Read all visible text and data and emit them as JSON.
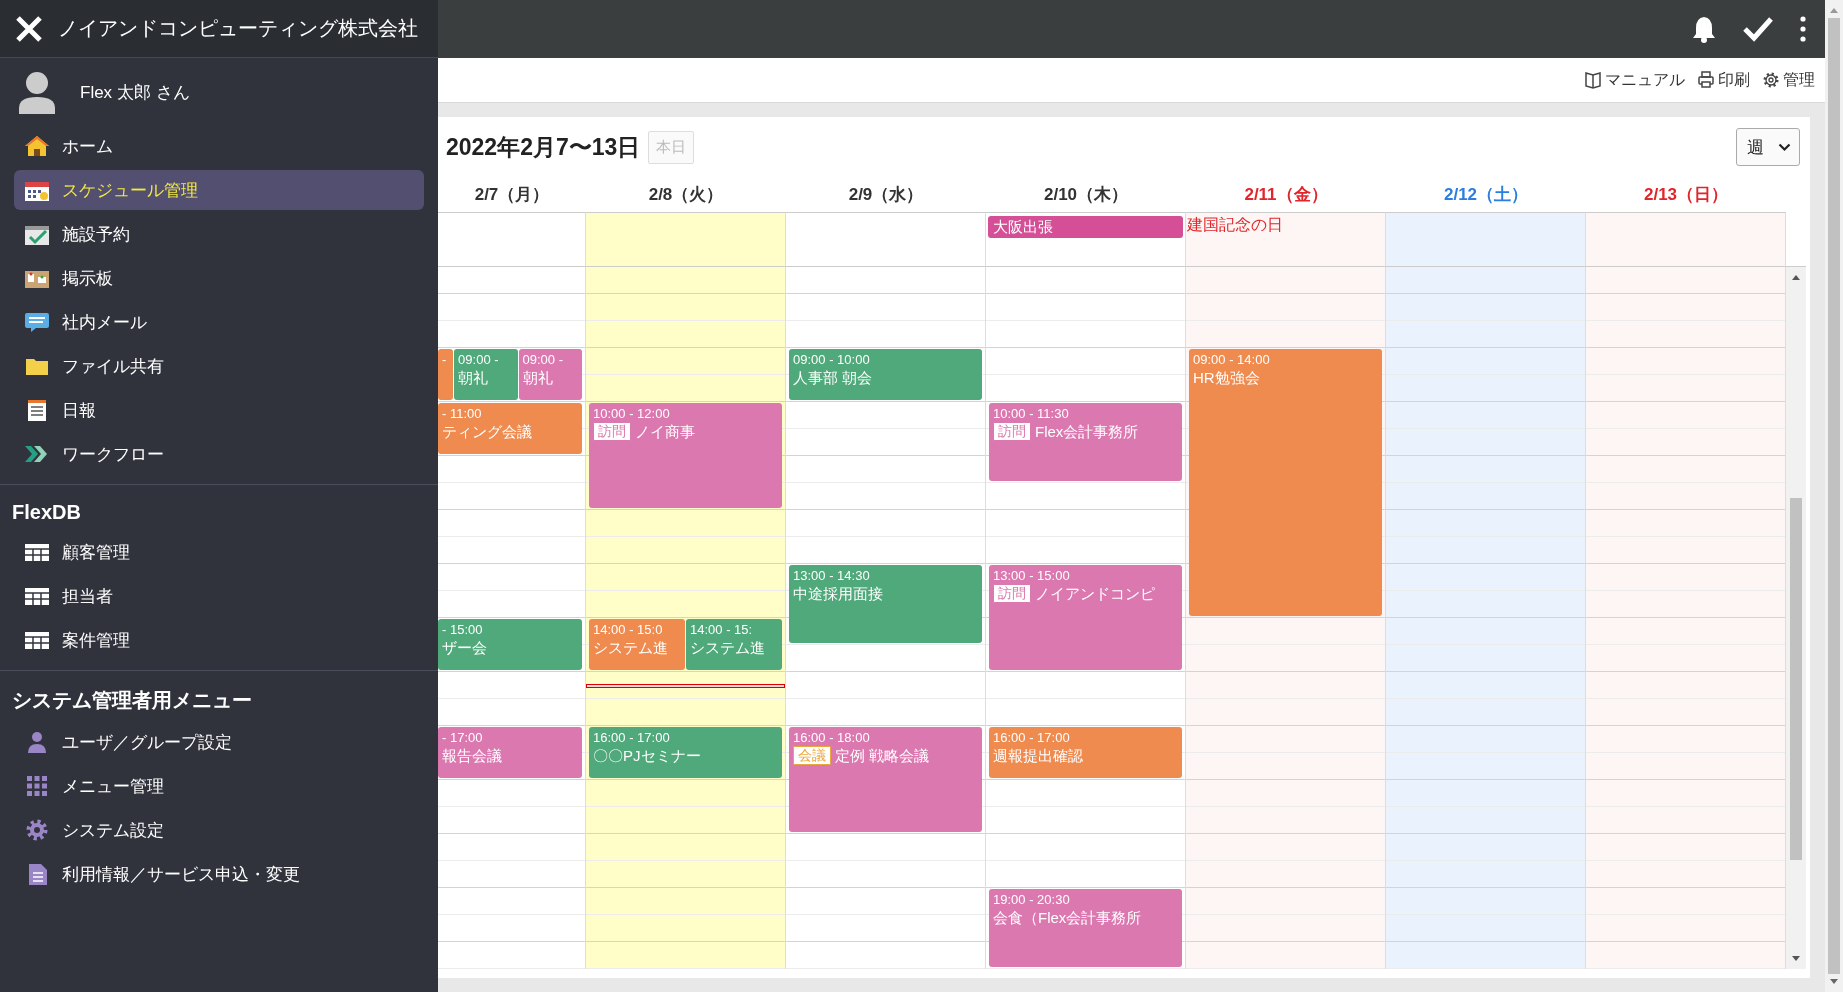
{
  "drawer": {
    "company": "ノイアンドコンピューティング株式会社",
    "user": "Flex 太郎 さん",
    "sections": [
      {
        "items": [
          {
            "label": "ホーム",
            "selected": false
          },
          {
            "label": "スケジュール管理",
            "selected": true
          },
          {
            "label": "施設予約",
            "selected": false
          },
          {
            "label": "掲示板",
            "selected": false
          },
          {
            "label": "社内メール",
            "selected": false
          },
          {
            "label": "ファイル共有",
            "selected": false
          },
          {
            "label": "日報",
            "selected": false
          },
          {
            "label": "ワークフロー",
            "selected": false
          }
        ]
      },
      {
        "heading": "FlexDB",
        "items": [
          {
            "label": "顧客管理",
            "selected": false
          },
          {
            "label": "担当者",
            "selected": false
          },
          {
            "label": "案件管理",
            "selected": false
          }
        ]
      },
      {
        "heading": "システム管理者用メニュー",
        "items": [
          {
            "label": "ユーザ／グループ設定",
            "selected": false
          },
          {
            "label": "メニュー管理",
            "selected": false
          },
          {
            "label": "システム設定",
            "selected": false
          },
          {
            "label": "利用情報／サービス申込・変更",
            "selected": false
          }
        ]
      }
    ]
  },
  "toolbar": {
    "links": [
      "マニュアル",
      "印刷",
      "管理"
    ]
  },
  "calendar": {
    "title": "2022年2月7〜13日",
    "today_button": {
      "label": "本日",
      "disabled": true
    },
    "view_select": {
      "value": "週"
    },
    "days": [
      {
        "label": "2/7（月）",
        "kind": "weekday",
        "today": false,
        "events": [
          {
            "time": "-",
            "color": "#ef8b4f"
          },
          {
            "time": "09:00 -",
            "title": "朝礼",
            "color": "#4fa97a"
          },
          {
            "time": "09:00 -",
            "title": "朝礼",
            "color": "#dc78b0"
          },
          {
            "time": "- 11:00",
            "title": "ティング会議",
            "color": "#ef8b4f"
          },
          {
            "time": "- 15:00",
            "title": "ザー会",
            "color": "#4fa97a"
          },
          {
            "time": "- 17:00",
            "title": "報告会議",
            "color": "#dc78b0"
          }
        ]
      },
      {
        "label": "2/8（火）",
        "kind": "weekday",
        "today": true,
        "events": [
          {
            "time": "10:00 - 12:00",
            "tag": {
              "label": "訪問",
              "color": "#dc78b0"
            },
            "title": "ノイ商事",
            "color": "#dc78b0"
          },
          {
            "time": "14:00 - 15:0",
            "title": "システム進",
            "color": "#ef8b4f"
          },
          {
            "time": "14:00 - 15:",
            "title": "システム進",
            "color": "#4fa97a"
          },
          {
            "time": "16:00 - 17:00",
            "title": "〇〇PJセミナー",
            "color": "#4fa97a"
          }
        ]
      },
      {
        "label": "2/9（水）",
        "kind": "weekday",
        "today": false,
        "events": [
          {
            "time": "09:00 - 10:00",
            "title": "人事部 朝会",
            "color": "#4fa97a"
          },
          {
            "time": "13:00 - 14:30",
            "title": "中途採用面接",
            "color": "#4fa97a"
          },
          {
            "time": "16:00 - 18:00",
            "tag": {
              "label": "会議",
              "color": "#eaa63a"
            },
            "title": "定例 戦略会議",
            "color": "#dc78b0"
          }
        ]
      },
      {
        "label": "2/10（木）",
        "kind": "weekday",
        "today": false,
        "all_day": [
          {
            "title": "大阪出張",
            "color": "#d44f96"
          }
        ],
        "events": [
          {
            "time": "10:00 - 11:30",
            "tag": {
              "label": "訪問",
              "color": "#dc78b0"
            },
            "title": "Flex会計事務所",
            "color": "#dc78b0"
          },
          {
            "time": "13:00 - 15:00",
            "tag": {
              "label": "訪問",
              "color": "#dc78b0"
            },
            "title": "ノイアンドコンピ",
            "color": "#dc78b0"
          },
          {
            "time": "16:00 - 17:00",
            "title": "週報提出確認",
            "color": "#ef8b4f"
          },
          {
            "time": "19:00 - 20:30",
            "title": "会食（Flex会計事務所",
            "color": "#dc78b0"
          }
        ]
      },
      {
        "label": "2/11（金）",
        "kind": "holiday",
        "today": false,
        "holiday_name": "建国記念の日",
        "events": [
          {
            "time": "09:00 - 14:00",
            "title": "HR勉強会",
            "color": "#ef8b4f"
          }
        ]
      },
      {
        "label": "2/12（土）",
        "kind": "saturday",
        "today": false
      },
      {
        "label": "2/13（日）",
        "kind": "holiday",
        "today": false
      }
    ]
  }
}
